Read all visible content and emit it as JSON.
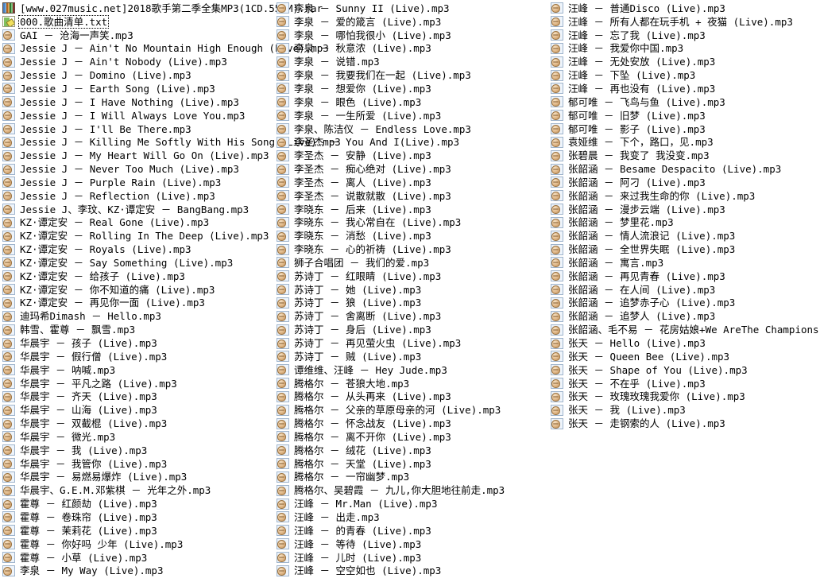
{
  "view": {
    "name": "file-list",
    "layout": "three-column-list",
    "background": "#ffffff",
    "text_color": "#000000"
  },
  "files": [
    {
      "name": "[www.027music.net]2018歌手第二季全集MP3(1CD.551M).rar",
      "icon": "archive-icon",
      "type": "rar",
      "selected": false
    },
    {
      "name": "000.歌曲清单.txt",
      "icon": "text-file-icon",
      "type": "txt",
      "selected": true
    },
    {
      "name": "GAI － 沧海一声笑.mp3",
      "icon": "audio-file-icon",
      "type": "mp3",
      "selected": false
    },
    {
      "name": "Jessie J － Ain't No Mountain High Enough (Live).mp3",
      "icon": "audio-file-icon",
      "type": "mp3",
      "selected": false
    },
    {
      "name": "Jessie J － Ain't Nobody (Live).mp3",
      "icon": "audio-file-icon",
      "type": "mp3",
      "selected": false
    },
    {
      "name": "Jessie J － Domino (Live).mp3",
      "icon": "audio-file-icon",
      "type": "mp3",
      "selected": false
    },
    {
      "name": "Jessie J － Earth Song (Live).mp3",
      "icon": "audio-file-icon",
      "type": "mp3",
      "selected": false
    },
    {
      "name": "Jessie J － I Have Nothing (Live).mp3",
      "icon": "audio-file-icon",
      "type": "mp3",
      "selected": false
    },
    {
      "name": "Jessie J － I Will Always Love You.mp3",
      "icon": "audio-file-icon",
      "type": "mp3",
      "selected": false
    },
    {
      "name": "Jessie J － I'll Be There.mp3",
      "icon": "audio-file-icon",
      "type": "mp3",
      "selected": false
    },
    {
      "name": "Jessie J － Killing Me Softly With His Song (Live).mp3",
      "icon": "audio-file-icon",
      "type": "mp3",
      "selected": false
    },
    {
      "name": "Jessie J － My Heart Will Go On (Live).mp3",
      "icon": "audio-file-icon",
      "type": "mp3",
      "selected": false
    },
    {
      "name": "Jessie J － Never Too Much (Live).mp3",
      "icon": "audio-file-icon",
      "type": "mp3",
      "selected": false
    },
    {
      "name": "Jessie J － Purple Rain (Live).mp3",
      "icon": "audio-file-icon",
      "type": "mp3",
      "selected": false
    },
    {
      "name": "Jessie J － Reflection (Live).mp3",
      "icon": "audio-file-icon",
      "type": "mp3",
      "selected": false
    },
    {
      "name": "Jessie J、李玟、KZ·谭定安 － BangBang.mp3",
      "icon": "audio-file-icon",
      "type": "mp3",
      "selected": false
    },
    {
      "name": "KZ·谭定安 － Real Gone (Live).mp3",
      "icon": "audio-file-icon",
      "type": "mp3",
      "selected": false
    },
    {
      "name": "KZ·谭定安 － Rolling In The Deep (Live).mp3",
      "icon": "audio-file-icon",
      "type": "mp3",
      "selected": false
    },
    {
      "name": "KZ·谭定安 － Royals (Live).mp3",
      "icon": "audio-file-icon",
      "type": "mp3",
      "selected": false
    },
    {
      "name": "KZ·谭定安 － Say Something (Live).mp3",
      "icon": "audio-file-icon",
      "type": "mp3",
      "selected": false
    },
    {
      "name": "KZ·谭定安 － 给孩子 (Live).mp3",
      "icon": "audio-file-icon",
      "type": "mp3",
      "selected": false
    },
    {
      "name": "KZ·谭定安 － 你不知道的痛 (Live).mp3",
      "icon": "audio-file-icon",
      "type": "mp3",
      "selected": false
    },
    {
      "name": "KZ·谭定安 － 再见你一面 (Live).mp3",
      "icon": "audio-file-icon",
      "type": "mp3",
      "selected": false
    },
    {
      "name": "迪玛希Dimash － Hello.mp3",
      "icon": "audio-file-icon",
      "type": "mp3",
      "selected": false
    },
    {
      "name": "韩雪、霍尊 － 飘雪.mp3",
      "icon": "audio-file-icon",
      "type": "mp3",
      "selected": false
    },
    {
      "name": "华晨宇 － 孩子 (Live).mp3",
      "icon": "audio-file-icon",
      "type": "mp3",
      "selected": false
    },
    {
      "name": "华晨宇 － 假行僧 (Live).mp3",
      "icon": "audio-file-icon",
      "type": "mp3",
      "selected": false
    },
    {
      "name": "华晨宇 － 呐喊.mp3",
      "icon": "audio-file-icon",
      "type": "mp3",
      "selected": false
    },
    {
      "name": "华晨宇 － 平凡之路 (Live).mp3",
      "icon": "audio-file-icon",
      "type": "mp3",
      "selected": false
    },
    {
      "name": "华晨宇 － 齐天 (Live).mp3",
      "icon": "audio-file-icon",
      "type": "mp3",
      "selected": false
    },
    {
      "name": "华晨宇 － 山海 (Live).mp3",
      "icon": "audio-file-icon",
      "type": "mp3",
      "selected": false
    },
    {
      "name": "华晨宇 － 双截棍 (Live).mp3",
      "icon": "audio-file-icon",
      "type": "mp3",
      "selected": false
    },
    {
      "name": "华晨宇 － 微光.mp3",
      "icon": "audio-file-icon",
      "type": "mp3",
      "selected": false
    },
    {
      "name": "华晨宇 － 我 (Live).mp3",
      "icon": "audio-file-icon",
      "type": "mp3",
      "selected": false
    },
    {
      "name": "华晨宇 － 我管你 (Live).mp3",
      "icon": "audio-file-icon",
      "type": "mp3",
      "selected": false
    },
    {
      "name": "华晨宇 － 易燃易爆炸 (Live).mp3",
      "icon": "audio-file-icon",
      "type": "mp3",
      "selected": false
    },
    {
      "name": "华晨宇、G.E.M.邓紫棋 － 光年之外.mp3",
      "icon": "audio-file-icon",
      "type": "mp3",
      "selected": false
    },
    {
      "name": "霍尊 － 红颜劫 (Live).mp3",
      "icon": "audio-file-icon",
      "type": "mp3",
      "selected": false
    },
    {
      "name": "霍尊 － 卷珠帘 (Live).mp3",
      "icon": "audio-file-icon",
      "type": "mp3",
      "selected": false
    },
    {
      "name": "霍尊 － 茉莉花 (Live).mp3",
      "icon": "audio-file-icon",
      "type": "mp3",
      "selected": false
    },
    {
      "name": "霍尊 － 你好吗 少年 (Live).mp3",
      "icon": "audio-file-icon",
      "type": "mp3",
      "selected": false
    },
    {
      "name": "霍尊 － 小草 (Live).mp3",
      "icon": "audio-file-icon",
      "type": "mp3",
      "selected": false
    },
    {
      "name": "李泉 － My Way (Live).mp3",
      "icon": "audio-file-icon",
      "type": "mp3",
      "selected": false
    },
    {
      "name": "李泉 － Sunny II (Live).mp3",
      "icon": "audio-file-icon",
      "type": "mp3",
      "selected": false
    },
    {
      "name": "李泉 － 爱的箴言 (Live).mp3",
      "icon": "audio-file-icon",
      "type": "mp3",
      "selected": false
    },
    {
      "name": "李泉 － 哪怕我很小 (Live).mp3",
      "icon": "audio-file-icon",
      "type": "mp3",
      "selected": false
    },
    {
      "name": "李泉 － 秋意浓 (Live).mp3",
      "icon": "audio-file-icon",
      "type": "mp3",
      "selected": false
    },
    {
      "name": "李泉 － 说错.mp3",
      "icon": "audio-file-icon",
      "type": "mp3",
      "selected": false
    },
    {
      "name": "李泉 － 我要我们在一起 (Live).mp3",
      "icon": "audio-file-icon",
      "type": "mp3",
      "selected": false
    },
    {
      "name": "李泉 － 想爱你 (Live).mp3",
      "icon": "audio-file-icon",
      "type": "mp3",
      "selected": false
    },
    {
      "name": "李泉 － 眼色 (Live).mp3",
      "icon": "audio-file-icon",
      "type": "mp3",
      "selected": false
    },
    {
      "name": "李泉 － 一生所爱 (Live).mp3",
      "icon": "audio-file-icon",
      "type": "mp3",
      "selected": false
    },
    {
      "name": "李泉、陈洁仪 － Endless Love.mp3",
      "icon": "audio-file-icon",
      "type": "mp3",
      "selected": false
    },
    {
      "name": "李圣杰 － You And I(Live).mp3",
      "icon": "audio-file-icon",
      "type": "mp3",
      "selected": false
    },
    {
      "name": "李圣杰 － 安静 (Live).mp3",
      "icon": "audio-file-icon",
      "type": "mp3",
      "selected": false
    },
    {
      "name": "李圣杰 － 痴心绝对 (Live).mp3",
      "icon": "audio-file-icon",
      "type": "mp3",
      "selected": false
    },
    {
      "name": "李圣杰 － 离人 (Live).mp3",
      "icon": "audio-file-icon",
      "type": "mp3",
      "selected": false
    },
    {
      "name": "李圣杰 － 说散就散 (Live).mp3",
      "icon": "audio-file-icon",
      "type": "mp3",
      "selected": false
    },
    {
      "name": "李晓东 － 后来 (Live).mp3",
      "icon": "audio-file-icon",
      "type": "mp3",
      "selected": false
    },
    {
      "name": "李晓东 － 我心常自在 (Live).mp3",
      "icon": "audio-file-icon",
      "type": "mp3",
      "selected": false
    },
    {
      "name": "李晓东 － 消愁 (Live).mp3",
      "icon": "audio-file-icon",
      "type": "mp3",
      "selected": false
    },
    {
      "name": "李晓东 － 心的祈祷 (Live).mp3",
      "icon": "audio-file-icon",
      "type": "mp3",
      "selected": false
    },
    {
      "name": "狮子合唱团 － 我们的爱.mp3",
      "icon": "audio-file-icon",
      "type": "mp3",
      "selected": false
    },
    {
      "name": "苏诗丁 － 红眼睛 (Live).mp3",
      "icon": "audio-file-icon",
      "type": "mp3",
      "selected": false
    },
    {
      "name": "苏诗丁 － 她 (Live).mp3",
      "icon": "audio-file-icon",
      "type": "mp3",
      "selected": false
    },
    {
      "name": "苏诗丁 － 狼 (Live).mp3",
      "icon": "audio-file-icon",
      "type": "mp3",
      "selected": false
    },
    {
      "name": "苏诗丁 － 舍离断 (Live).mp3",
      "icon": "audio-file-icon",
      "type": "mp3",
      "selected": false
    },
    {
      "name": "苏诗丁 － 身后 (Live).mp3",
      "icon": "audio-file-icon",
      "type": "mp3",
      "selected": false
    },
    {
      "name": "苏诗丁 － 再见萤火虫 (Live).mp3",
      "icon": "audio-file-icon",
      "type": "mp3",
      "selected": false
    },
    {
      "name": "苏诗丁 － 贼 (Live).mp3",
      "icon": "audio-file-icon",
      "type": "mp3",
      "selected": false
    },
    {
      "name": "谭维维、汪峰 － Hey Jude.mp3",
      "icon": "audio-file-icon",
      "type": "mp3",
      "selected": false
    },
    {
      "name": "腾格尔 － 苍狼大地.mp3",
      "icon": "audio-file-icon",
      "type": "mp3",
      "selected": false
    },
    {
      "name": "腾格尔 － 从头再来 (Live).mp3",
      "icon": "audio-file-icon",
      "type": "mp3",
      "selected": false
    },
    {
      "name": "腾格尔 － 父亲的草原母亲的河 (Live).mp3",
      "icon": "audio-file-icon",
      "type": "mp3",
      "selected": false
    },
    {
      "name": "腾格尔 － 怀念战友 (Live).mp3",
      "icon": "audio-file-icon",
      "type": "mp3",
      "selected": false
    },
    {
      "name": "腾格尔 － 离不开你 (Live).mp3",
      "icon": "audio-file-icon",
      "type": "mp3",
      "selected": false
    },
    {
      "name": "腾格尔 － 绒花 (Live).mp3",
      "icon": "audio-file-icon",
      "type": "mp3",
      "selected": false
    },
    {
      "name": "腾格尔 － 天堂 (Live).mp3",
      "icon": "audio-file-icon",
      "type": "mp3",
      "selected": false
    },
    {
      "name": "腾格尔 － 一帘幽梦.mp3",
      "icon": "audio-file-icon",
      "type": "mp3",
      "selected": false
    },
    {
      "name": "腾格尔、吴碧霞 － 九儿,你大胆地往前走.mp3",
      "icon": "audio-file-icon",
      "type": "mp3",
      "selected": false
    },
    {
      "name": "汪峰 － Mr.Man (Live).mp3",
      "icon": "audio-file-icon",
      "type": "mp3",
      "selected": false
    },
    {
      "name": "汪峰 － 出走.mp3",
      "icon": "audio-file-icon",
      "type": "mp3",
      "selected": false
    },
    {
      "name": "汪峰 － 的青春 (Live).mp3",
      "icon": "audio-file-icon",
      "type": "mp3",
      "selected": false
    },
    {
      "name": "汪峰 － 等待 (Live).mp3",
      "icon": "audio-file-icon",
      "type": "mp3",
      "selected": false
    },
    {
      "name": "汪峰 － 儿时 (Live).mp3",
      "icon": "audio-file-icon",
      "type": "mp3",
      "selected": false
    },
    {
      "name": "汪峰 － 空空如也 (Live).mp3",
      "icon": "audio-file-icon",
      "type": "mp3",
      "selected": false
    },
    {
      "name": "汪峰 － 普通Disco (Live).mp3",
      "icon": "audio-file-icon",
      "type": "mp3",
      "selected": false
    },
    {
      "name": "汪峰 － 所有人都在玩手机 + 夜猫 (Live).mp3",
      "icon": "audio-file-icon",
      "type": "mp3",
      "selected": false
    },
    {
      "name": "汪峰 － 忘了我 (Live).mp3",
      "icon": "audio-file-icon",
      "type": "mp3",
      "selected": false
    },
    {
      "name": "汪峰 － 我爱你中国.mp3",
      "icon": "audio-file-icon",
      "type": "mp3",
      "selected": false
    },
    {
      "name": "汪峰 － 无处安放 (Live).mp3",
      "icon": "audio-file-icon",
      "type": "mp3",
      "selected": false
    },
    {
      "name": "汪峰 － 下坠 (Live).mp3",
      "icon": "audio-file-icon",
      "type": "mp3",
      "selected": false
    },
    {
      "name": "汪峰 － 再也没有 (Live).mp3",
      "icon": "audio-file-icon",
      "type": "mp3",
      "selected": false
    },
    {
      "name": "郁可唯 － 飞鸟与鱼 (Live).mp3",
      "icon": "audio-file-icon",
      "type": "mp3",
      "selected": false
    },
    {
      "name": "郁可唯 － 旧梦 (Live).mp3",
      "icon": "audio-file-icon",
      "type": "mp3",
      "selected": false
    },
    {
      "name": "郁可唯 － 影子 (Live).mp3",
      "icon": "audio-file-icon",
      "type": "mp3",
      "selected": false
    },
    {
      "name": "袁娅维 － 下个，路口，见.mp3",
      "icon": "audio-file-icon",
      "type": "mp3",
      "selected": false
    },
    {
      "name": "张碧晨 － 我变了 我没变.mp3",
      "icon": "audio-file-icon",
      "type": "mp3",
      "selected": false
    },
    {
      "name": "张韶涵 － Besame Despacito (Live).mp3",
      "icon": "audio-file-icon",
      "type": "mp3",
      "selected": false
    },
    {
      "name": "张韶涵 － 阿刁 (Live).mp3",
      "icon": "audio-file-icon",
      "type": "mp3",
      "selected": false
    },
    {
      "name": "张韶涵 － 来过我生命的你 (Live).mp3",
      "icon": "audio-file-icon",
      "type": "mp3",
      "selected": false
    },
    {
      "name": "张韶涵 － 漫步云端 (Live).mp3",
      "icon": "audio-file-icon",
      "type": "mp3",
      "selected": false
    },
    {
      "name": "张韶涵 － 梦里花.mp3",
      "icon": "audio-file-icon",
      "type": "mp3",
      "selected": false
    },
    {
      "name": "张韶涵 － 情人流浪记 (Live).mp3",
      "icon": "audio-file-icon",
      "type": "mp3",
      "selected": false
    },
    {
      "name": "张韶涵 － 全世界失眠 (Live).mp3",
      "icon": "audio-file-icon",
      "type": "mp3",
      "selected": false
    },
    {
      "name": "张韶涵 － 寓言.mp3",
      "icon": "audio-file-icon",
      "type": "mp3",
      "selected": false
    },
    {
      "name": "张韶涵 － 再见青春 (Live).mp3",
      "icon": "audio-file-icon",
      "type": "mp3",
      "selected": false
    },
    {
      "name": "张韶涵 － 在人间 (Live).mp3",
      "icon": "audio-file-icon",
      "type": "mp3",
      "selected": false
    },
    {
      "name": "张韶涵 － 追梦赤子心 (Live).mp3",
      "icon": "audio-file-icon",
      "type": "mp3",
      "selected": false
    },
    {
      "name": "张韶涵 － 追梦人 (Live).mp3",
      "icon": "audio-file-icon",
      "type": "mp3",
      "selected": false
    },
    {
      "name": "张韶涵、毛不易 － 花房姑娘+We AreThe Champions.mp3",
      "icon": "audio-file-icon",
      "type": "mp3",
      "selected": false
    },
    {
      "name": "张天 － Hello (Live).mp3",
      "icon": "audio-file-icon",
      "type": "mp3",
      "selected": false
    },
    {
      "name": "张天 － Queen Bee (Live).mp3",
      "icon": "audio-file-icon",
      "type": "mp3",
      "selected": false
    },
    {
      "name": "张天 － Shape of You (Live).mp3",
      "icon": "audio-file-icon",
      "type": "mp3",
      "selected": false
    },
    {
      "name": "张天 － 不在乎 (Live).mp3",
      "icon": "audio-file-icon",
      "type": "mp3",
      "selected": false
    },
    {
      "name": "张天 － 玫瑰玫瑰我爱你 (Live).mp3",
      "icon": "audio-file-icon",
      "type": "mp3",
      "selected": false
    },
    {
      "name": "张天 － 我 (Live).mp3",
      "icon": "audio-file-icon",
      "type": "mp3",
      "selected": false
    },
    {
      "name": "张天 － 走钢索的人 (Live).mp3",
      "icon": "audio-file-icon",
      "type": "mp3",
      "selected": false
    }
  ]
}
